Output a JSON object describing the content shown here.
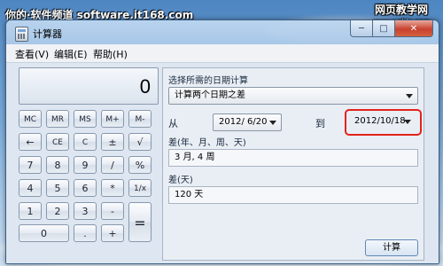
{
  "overlay_caption": "你的·软件频道 software.it168.com",
  "watermark": {
    "text": "网页教学网",
    "url": "www.webjx.com"
  },
  "window": {
    "title": "计算器",
    "controls": {
      "minimize": "─",
      "maximize": "□",
      "close": "✕"
    }
  },
  "menu": [
    "查看(V)",
    "编辑(E)",
    "帮助(H)"
  ],
  "display": {
    "value": "0"
  },
  "keys": [
    [
      "MC",
      "MR",
      "MS",
      "M+",
      "M-"
    ],
    [
      "←",
      "CE",
      "C",
      "±",
      "√"
    ],
    [
      "7",
      "8",
      "9",
      "/",
      "%"
    ],
    [
      "4",
      "5",
      "6",
      "*",
      "1/x"
    ],
    [
      "1",
      "2",
      "3",
      "-",
      "="
    ],
    [
      "0",
      ".",
      "+"
    ]
  ],
  "date_panel": {
    "prompt": "选择所需的日期计算",
    "mode_selected": "计算两个日期之差",
    "from_label": "从",
    "from_date": "2012/ 6/20",
    "to_label": "到",
    "to_date": "2012/10/18",
    "diff_label": "差(年、月、周、天)",
    "diff_value": "3 月, 4 周",
    "days_label": "差(天)",
    "days_value": "120 天",
    "calculate_button": "计算"
  },
  "colors": {
    "highlight": "#e2231a",
    "titlebar": "#aac8e8"
  }
}
